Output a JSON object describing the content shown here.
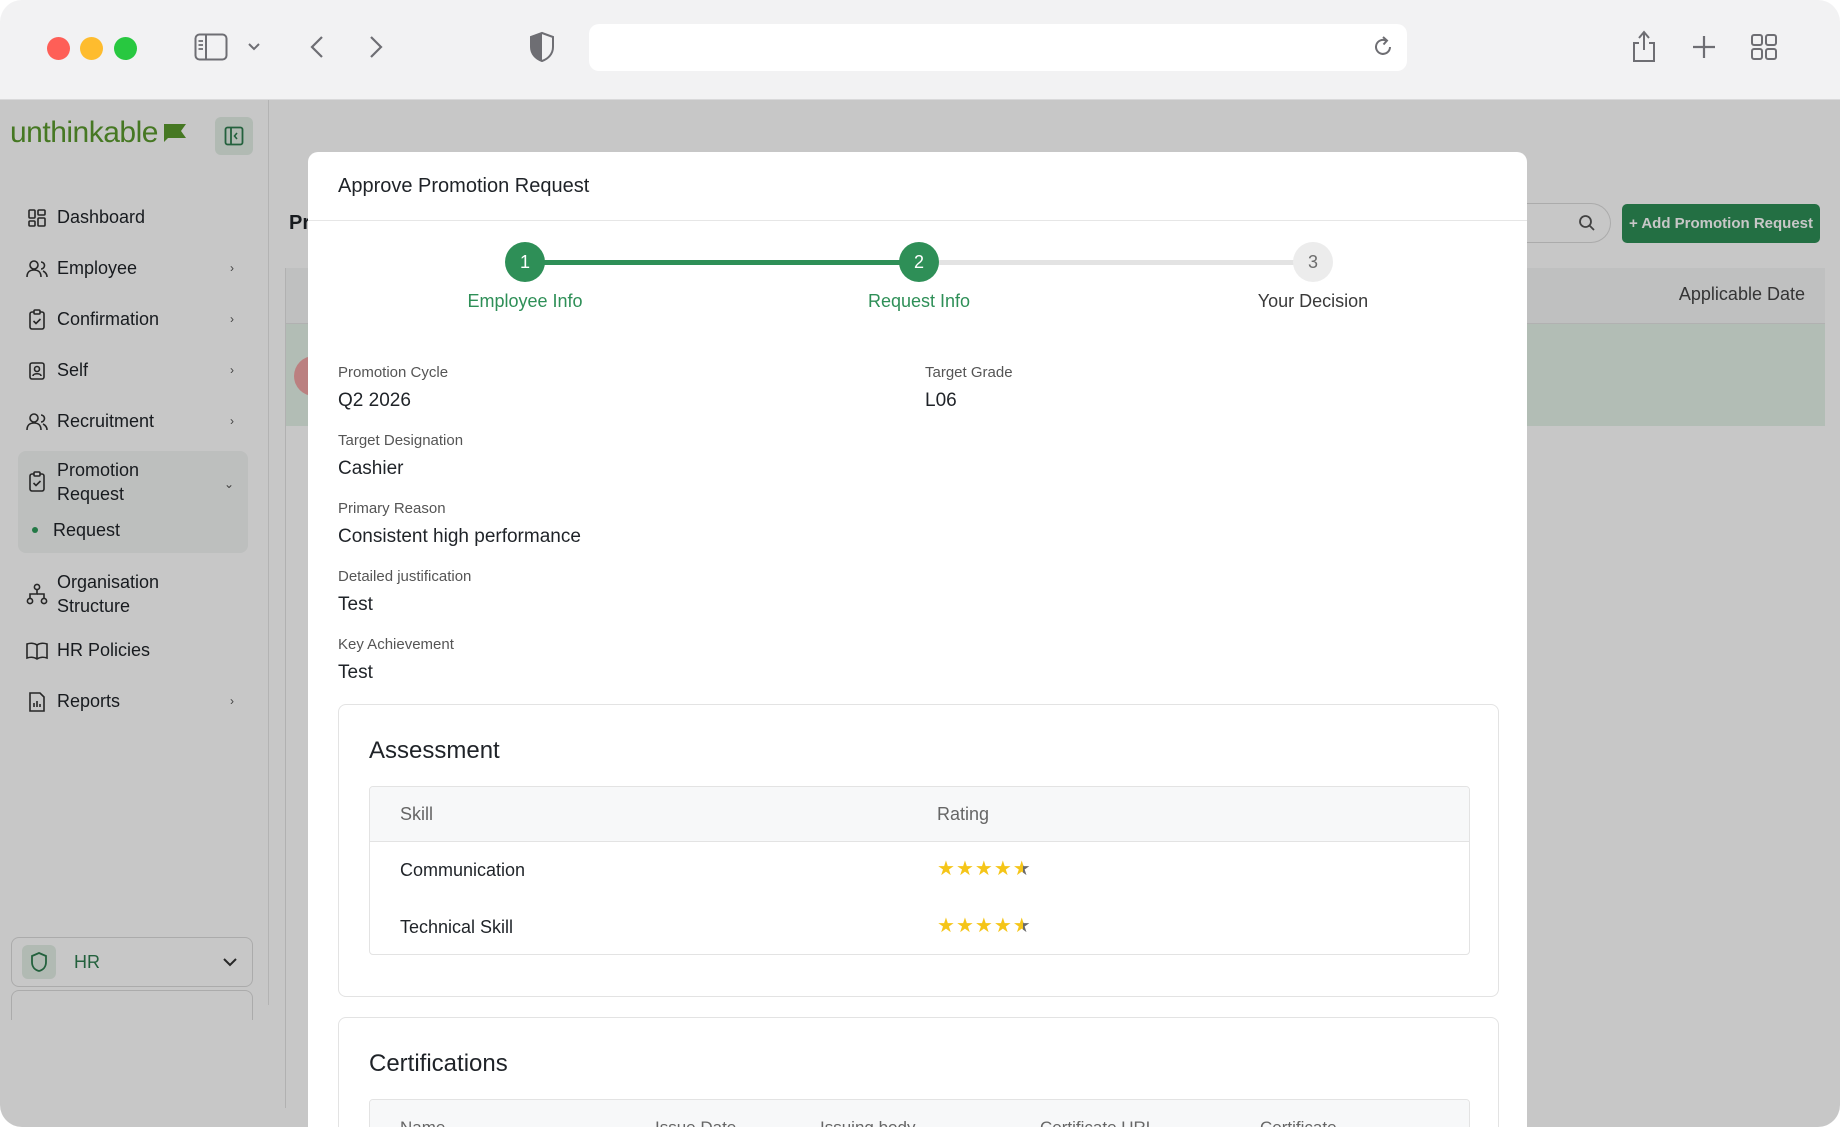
{
  "browser": {
    "url": ""
  },
  "app": {
    "brand": "unthinkable",
    "page_title": "Pr",
    "add_button": "+ Add Promotion Request",
    "table_header_right": "Applicable Date",
    "sidebar": {
      "items": [
        {
          "label": "Dashboard",
          "icon": "dashboard-icon",
          "chevron": false
        },
        {
          "label": "Employee",
          "icon": "users-icon",
          "chevron": true
        },
        {
          "label": "Confirmation",
          "icon": "clipboard-check-icon",
          "chevron": true
        },
        {
          "label": "Self",
          "icon": "id-badge-icon",
          "chevron": true
        },
        {
          "label": "Recruitment",
          "icon": "users-icon",
          "chevron": true
        }
      ],
      "promotion": {
        "label_line1": "Promotion",
        "label_line2": "Request",
        "sub_item": "Request"
      },
      "items_after": [
        {
          "label_line1": "Organisation",
          "label_line2": "Structure"
        },
        {
          "label": "HR Policies"
        },
        {
          "label": "Reports"
        }
      ],
      "role": "HR"
    }
  },
  "modal": {
    "title": "Approve Promotion Request",
    "steps": [
      {
        "number": "1",
        "label": "Employee Info",
        "state": "done"
      },
      {
        "number": "2",
        "label": "Request Info",
        "state": "done"
      },
      {
        "number": "3",
        "label": "Your Decision",
        "state": "todo"
      }
    ],
    "fields": {
      "promotion_cycle": {
        "label": "Promotion Cycle",
        "value": "Q2 2026"
      },
      "target_grade": {
        "label": "Target Grade",
        "value": "L06"
      },
      "target_designation": {
        "label": "Target Designation",
        "value": "Cashier"
      },
      "primary_reason": {
        "label": "Primary Reason",
        "value": "Consistent high performance"
      },
      "detailed_justification": {
        "label": "Detailed justification",
        "value": "Test"
      },
      "key_achievement": {
        "label": "Key Achievement",
        "value": "Test"
      }
    },
    "assessment": {
      "title": "Assessment",
      "columns": [
        "Skill",
        "Rating"
      ],
      "rows": [
        {
          "skill": "Communication",
          "rating": 4.5
        },
        {
          "skill": "Technical Skill",
          "rating": 4.5
        }
      ]
    },
    "certifications": {
      "title": "Certifications",
      "columns": [
        "Name",
        "Issue Date",
        "Issuing body",
        "Certificate URL",
        "Certificate"
      ]
    }
  },
  "colors": {
    "primary_green": "#2e8f57",
    "brand_green": "#5a9a2e",
    "star": "#f5c518"
  }
}
